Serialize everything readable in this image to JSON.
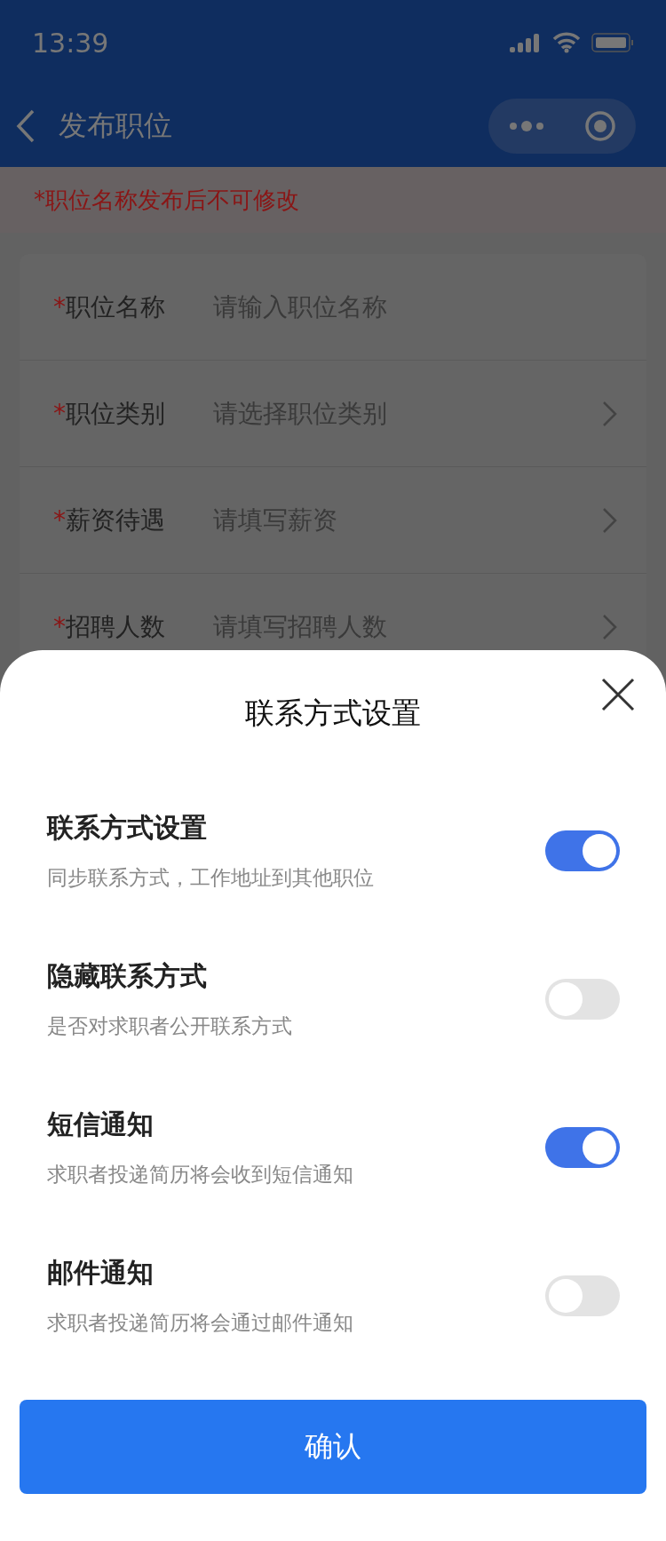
{
  "status_bar": {
    "time": "13:39"
  },
  "nav": {
    "title": "发布职位"
  },
  "notice": "*职位名称发布后不可修改",
  "form": [
    {
      "required_mark": "*",
      "label": "职位名称",
      "placeholder": "请输入职位名称",
      "kind": "input"
    },
    {
      "required_mark": "*",
      "label": "职位类别",
      "placeholder": "请选择职位类别",
      "kind": "select"
    },
    {
      "required_mark": "*",
      "label": "薪资待遇",
      "placeholder": "请填写薪资",
      "kind": "select"
    },
    {
      "required_mark": "*",
      "label": "招聘人数",
      "placeholder": "请填写招聘人数",
      "kind": "select"
    }
  ],
  "sheet": {
    "title": "联系方式设置",
    "settings": [
      {
        "title": "联系方式设置",
        "description": "同步联系方式，工作地址到其他职位",
        "on": true
      },
      {
        "title": "隐藏联系方式",
        "description": "是否对求职者公开联系方式",
        "on": false
      },
      {
        "title": "短信通知",
        "description": "求职者投递简历将会收到短信通知",
        "on": true
      },
      {
        "title": "邮件通知",
        "description": "求职者投递简历将会通过邮件通知",
        "on": false
      }
    ],
    "confirm": "确认"
  }
}
